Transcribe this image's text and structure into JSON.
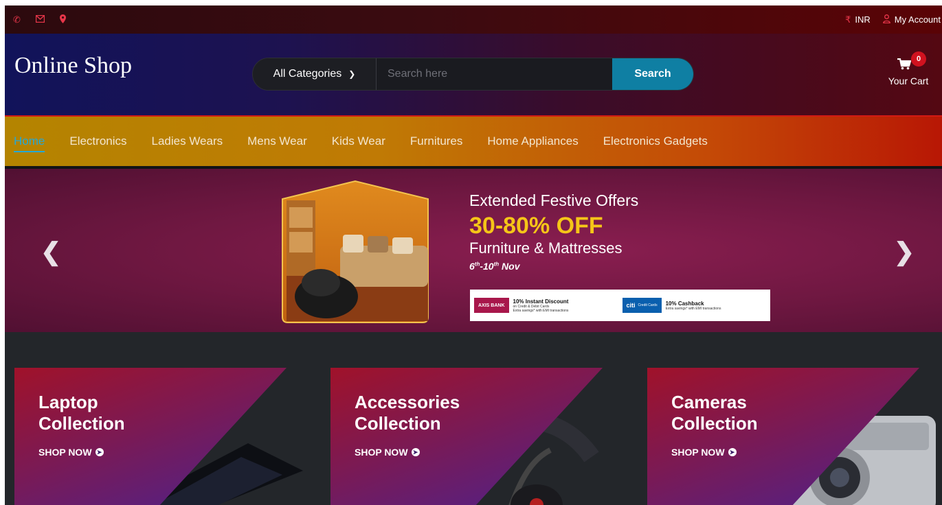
{
  "topbar": {
    "currency_symbol": "₹",
    "currency": "INR",
    "account": "My Account"
  },
  "header": {
    "logo": "Online Shop",
    "category_selected": "All Categories",
    "search_placeholder": "Search here",
    "search_button": "Search",
    "cart_count": "0",
    "cart_label": "Your Cart"
  },
  "nav": [
    {
      "label": "Home",
      "active": true
    },
    {
      "label": "Electronics"
    },
    {
      "label": "Ladies Wears"
    },
    {
      "label": "Mens Wear"
    },
    {
      "label": "Kids Wear"
    },
    {
      "label": "Furnitures"
    },
    {
      "label": "Home Appliances"
    },
    {
      "label": "Electronics Gadgets"
    }
  ],
  "banner": {
    "title": "Extended Festive Offers",
    "offer": "30-80% OFF",
    "category": "Furniture & Mattresses",
    "date_start": "6",
    "date_start_sup": "th",
    "date_mid": "-10",
    "date_end_sup": "th",
    "date_end": " Nov",
    "bank1_logo": "AXIS BANK",
    "bank1_title": "10% Instant Discount",
    "bank1_sub": "on Credit & Debit Cards",
    "bank1_note": "Extra savings* with EMI transactions",
    "bank2_logo": "citi",
    "bank2_logo_sub": "Credit Cards",
    "bank2_title": "10% Cashback",
    "bank2_note": "Extra savings* with EMI transactions"
  },
  "collections": [
    {
      "line1": "Laptop",
      "line2": "Collection",
      "cta": "SHOP NOW"
    },
    {
      "line1": "Accessories",
      "line2": "Collection",
      "cta": "SHOP NOW"
    },
    {
      "line1": "Cameras",
      "line2": "Collection",
      "cta": "SHOP NOW"
    }
  ],
  "colors": {
    "accent_red": "#e8364a",
    "search_button": "#0f7fa3",
    "nav_active": "#23a9d8",
    "offer_yellow": "#f5c518"
  },
  "icons": [
    "phone-icon",
    "mail-icon",
    "location-icon",
    "user-icon",
    "cart-icon",
    "chevron-left-icon",
    "chevron-right-icon",
    "arrow-circle-right-icon"
  ]
}
